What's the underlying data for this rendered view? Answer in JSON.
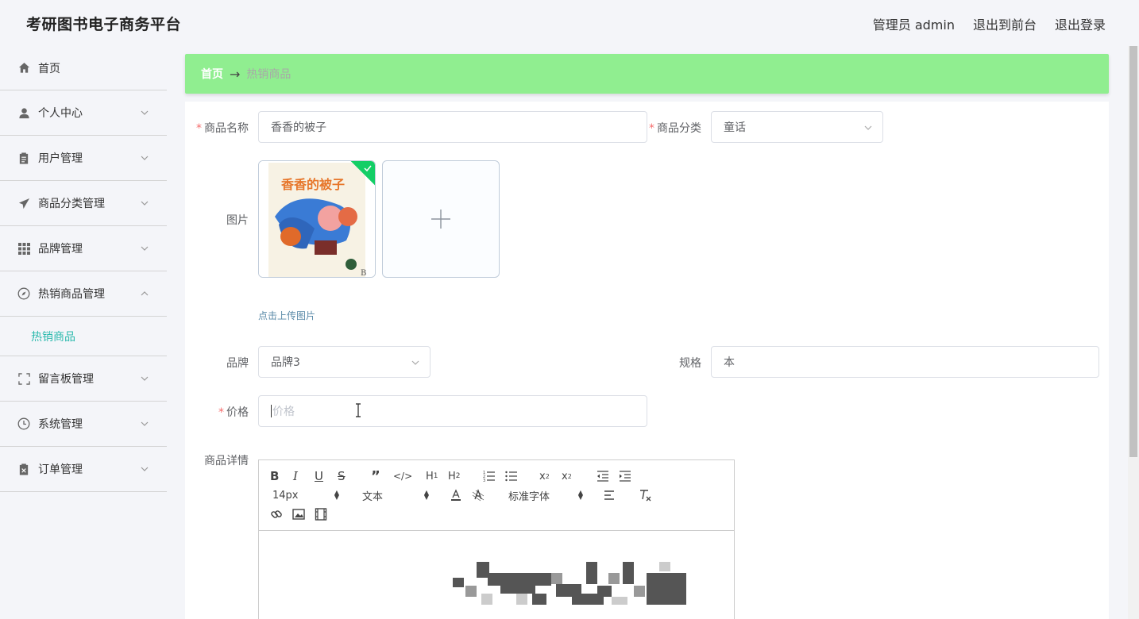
{
  "app": {
    "title": "考研图书电子商务平台",
    "user_label": "管理员 admin",
    "to_front_label": "退出到前台",
    "logout_label": "退出登录"
  },
  "sidebar": {
    "items": [
      {
        "label": "首页",
        "icon": "home-icon"
      },
      {
        "label": "个人中心",
        "icon": "user-icon"
      },
      {
        "label": "用户管理",
        "icon": "clipboard-icon"
      },
      {
        "label": "商品分类管理",
        "icon": "send-icon"
      },
      {
        "label": "品牌管理",
        "icon": "grid-icon"
      },
      {
        "label": "热销商品管理",
        "icon": "compass-icon"
      },
      {
        "label": "留言板管理",
        "icon": "fullscreen-icon"
      },
      {
        "label": "系统管理",
        "icon": "clock-icon"
      },
      {
        "label": "订单管理",
        "icon": "delete-clipboard-icon"
      }
    ],
    "submenu_active": "热销商品"
  },
  "breadcrumb": {
    "home": "首页",
    "separator": "→",
    "current": "热销商品"
  },
  "form": {
    "name_label": "商品名称",
    "name_value": "香香的被子",
    "category_label": "商品分类",
    "category_value": "童话",
    "image_label": "图片",
    "upload_tip": "点击上传图片",
    "book_cover_title": "香香的被子",
    "brand_label": "品牌",
    "brand_value": "品牌3",
    "spec_label": "规格",
    "spec_value": "本",
    "price_label": "价格",
    "price_placeholder": "价格",
    "detail_label": "商品详情"
  },
  "editor": {
    "font_size": "14px",
    "header_select": "文本",
    "font_family": "标准字体",
    "buttons": [
      "bold",
      "italic",
      "underline",
      "strike",
      "blockquote",
      "code-block",
      "h1",
      "h2",
      "ordered-list",
      "bullet-list",
      "subscript",
      "superscript",
      "outdent",
      "indent",
      "color",
      "background",
      "align",
      "clean",
      "link",
      "image",
      "video"
    ]
  },
  "colors": {
    "accent": "#2bb9ad",
    "breadcrumb_bg": "#90ee90",
    "required": "#f56c6c",
    "success": "#13ce66"
  }
}
